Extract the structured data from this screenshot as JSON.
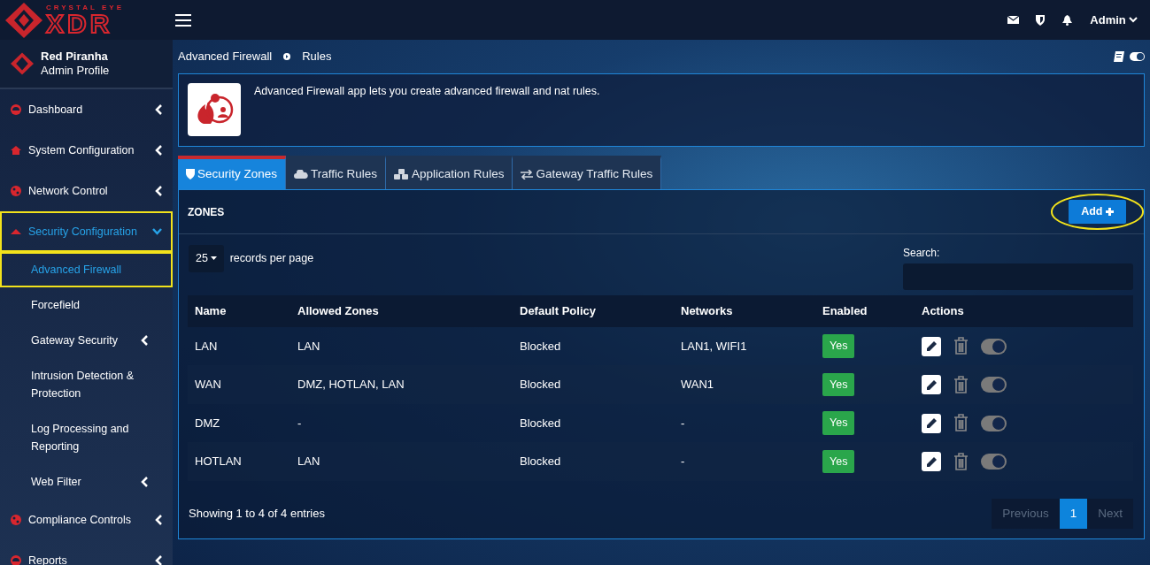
{
  "brand": {
    "tagline": "CRYSTAL EYE",
    "name": "XDR"
  },
  "topbar": {
    "user": "Admin"
  },
  "profile": {
    "name": "Red Piranha",
    "role": "Admin Profile"
  },
  "sidebar": {
    "items": [
      {
        "label": "Dashboard",
        "expanded": false,
        "selected": false,
        "highlighted": false
      },
      {
        "label": "System Configuration",
        "expanded": false,
        "selected": false,
        "highlighted": false
      },
      {
        "label": "Network Control",
        "expanded": false,
        "selected": false,
        "highlighted": false
      },
      {
        "label": "Security Configuration",
        "expanded": true,
        "selected": true,
        "highlighted": true,
        "children": [
          {
            "label": "Advanced Firewall",
            "submenu": false,
            "selected": true,
            "highlighted": true
          },
          {
            "label": "Forcefield",
            "submenu": false,
            "selected": false,
            "highlighted": false
          },
          {
            "label": "Gateway Security",
            "submenu": true,
            "selected": false,
            "highlighted": false
          },
          {
            "label": "Intrusion Detection & Protection",
            "submenu": false,
            "selected": false,
            "highlighted": false
          },
          {
            "label": "Log Processing and Reporting",
            "submenu": false,
            "selected": false,
            "highlighted": false
          },
          {
            "label": "Web Filter",
            "submenu": true,
            "selected": false,
            "highlighted": false
          }
        ]
      },
      {
        "label": "Compliance Controls",
        "expanded": false,
        "selected": false,
        "highlighted": false
      },
      {
        "label": "Reports",
        "expanded": false,
        "selected": false,
        "highlighted": false
      }
    ]
  },
  "breadcrumb": [
    "Advanced Firewall",
    "Rules"
  ],
  "app_info": {
    "description": "Advanced Firewall app lets you create advanced firewall and nat rules."
  },
  "tabs": [
    {
      "label": "Security Zones",
      "selected": true
    },
    {
      "label": "Traffic Rules",
      "selected": false
    },
    {
      "label": "Application Rules",
      "selected": false
    },
    {
      "label": "Gateway Traffic Rules",
      "selected": false
    }
  ],
  "panel": {
    "title": "ZONES",
    "add_button": {
      "label": "Add",
      "highlighted": true
    },
    "page_size": "25",
    "page_size_label": "records per page",
    "search_label": "Search:"
  },
  "table": {
    "columns": [
      "Name",
      "Allowed Zones",
      "Default Policy",
      "Networks",
      "Enabled",
      "Actions"
    ],
    "rows": [
      {
        "name": "LAN",
        "allowed_zones": "LAN",
        "default_policy": "Blocked",
        "networks": "LAN1, WIFI1",
        "enabled": "Yes",
        "on": true
      },
      {
        "name": "WAN",
        "allowed_zones": "DMZ, HOTLAN, LAN",
        "default_policy": "Blocked",
        "networks": "WAN1",
        "enabled": "Yes",
        "on": true
      },
      {
        "name": "DMZ",
        "allowed_zones": "-",
        "default_policy": "Blocked",
        "networks": "-",
        "enabled": "Yes",
        "on": true
      },
      {
        "name": "HOTLAN",
        "allowed_zones": "LAN",
        "default_policy": "Blocked",
        "networks": "-",
        "enabled": "Yes",
        "on": true
      }
    ]
  },
  "footer": {
    "summary": "Showing 1 to 4 of 4 entries",
    "pages": [
      {
        "label": "Previous",
        "disabled": true,
        "selected": false
      },
      {
        "label": "1",
        "disabled": false,
        "selected": true
      },
      {
        "label": "Next",
        "disabled": true,
        "selected": false
      }
    ]
  }
}
